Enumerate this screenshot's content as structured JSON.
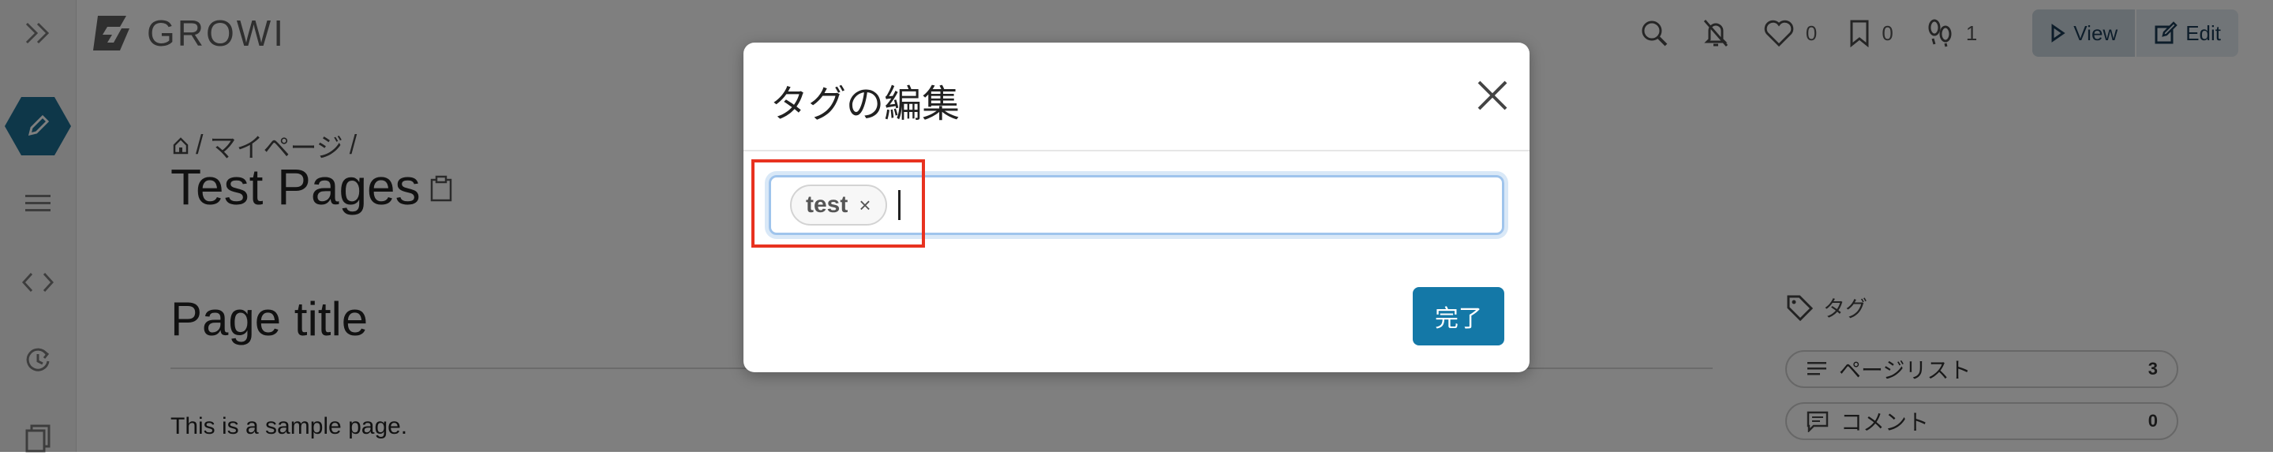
{
  "app": {
    "logo_text": "GROWI"
  },
  "topbar": {
    "like_count": "0",
    "bookmark_count": "0",
    "seen_count": "1",
    "view_label": "View",
    "edit_label": "Edit"
  },
  "page": {
    "breadcrumb_separator": "/",
    "breadcrumb_mypage": "マイページ",
    "title": "Test Pages",
    "heading": "Page title",
    "body_text": "This is a sample page."
  },
  "right_panel": {
    "tag_heading": "タグ",
    "pagelist_label": "ページリスト",
    "pagelist_count": "3",
    "comment_label": "コメント",
    "comment_count": "0"
  },
  "modal": {
    "title": "タグの編集",
    "tags": [
      "test"
    ],
    "remove_glyph": "×",
    "done_label": "完了"
  },
  "colors": {
    "brand": "#1c6f93",
    "primary_button": "#1478a7",
    "annotation": "#e8321f"
  },
  "icons": [
    "sidebar-toggle-icon",
    "pencil-icon",
    "list-icon",
    "code-icon",
    "history-icon",
    "page-tree-icon",
    "search-icon",
    "bell-off-icon",
    "heart-icon",
    "bookmark-icon",
    "footprints-icon",
    "play-icon",
    "edit-icon",
    "home-icon",
    "clipboard-icon",
    "tag-icon",
    "close-icon"
  ]
}
